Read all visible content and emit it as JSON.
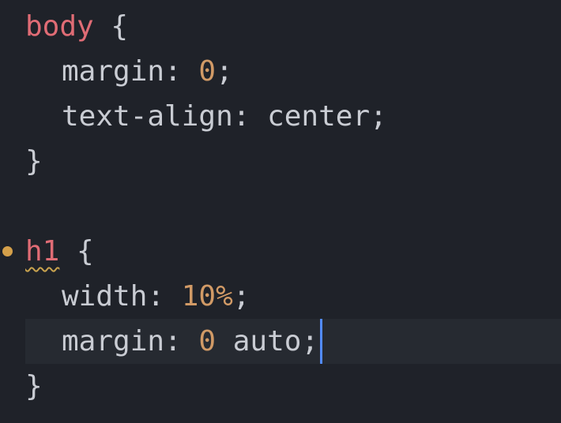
{
  "colors": {
    "background": "#1f2229",
    "selector": "#e06c75",
    "property": "#c9ccd3",
    "number": "#d19a66",
    "cursor": "#528bff",
    "modified_dot": "#d4a04a"
  },
  "code": {
    "rule1": {
      "selector": "body",
      "open": " {",
      "decl1": {
        "prop": "margin: ",
        "value": "0",
        "end": ";"
      },
      "decl2": {
        "prop": "text-align: center",
        "end": ";"
      },
      "close": "}"
    },
    "rule2": {
      "selector": "h1",
      "open": " {",
      "decl1": {
        "prop": "width: ",
        "value": "10%",
        "end": ";"
      },
      "decl2": {
        "prop": "margin: ",
        "value": "0",
        "rest": " auto",
        "end": ";"
      },
      "close": "}"
    }
  }
}
